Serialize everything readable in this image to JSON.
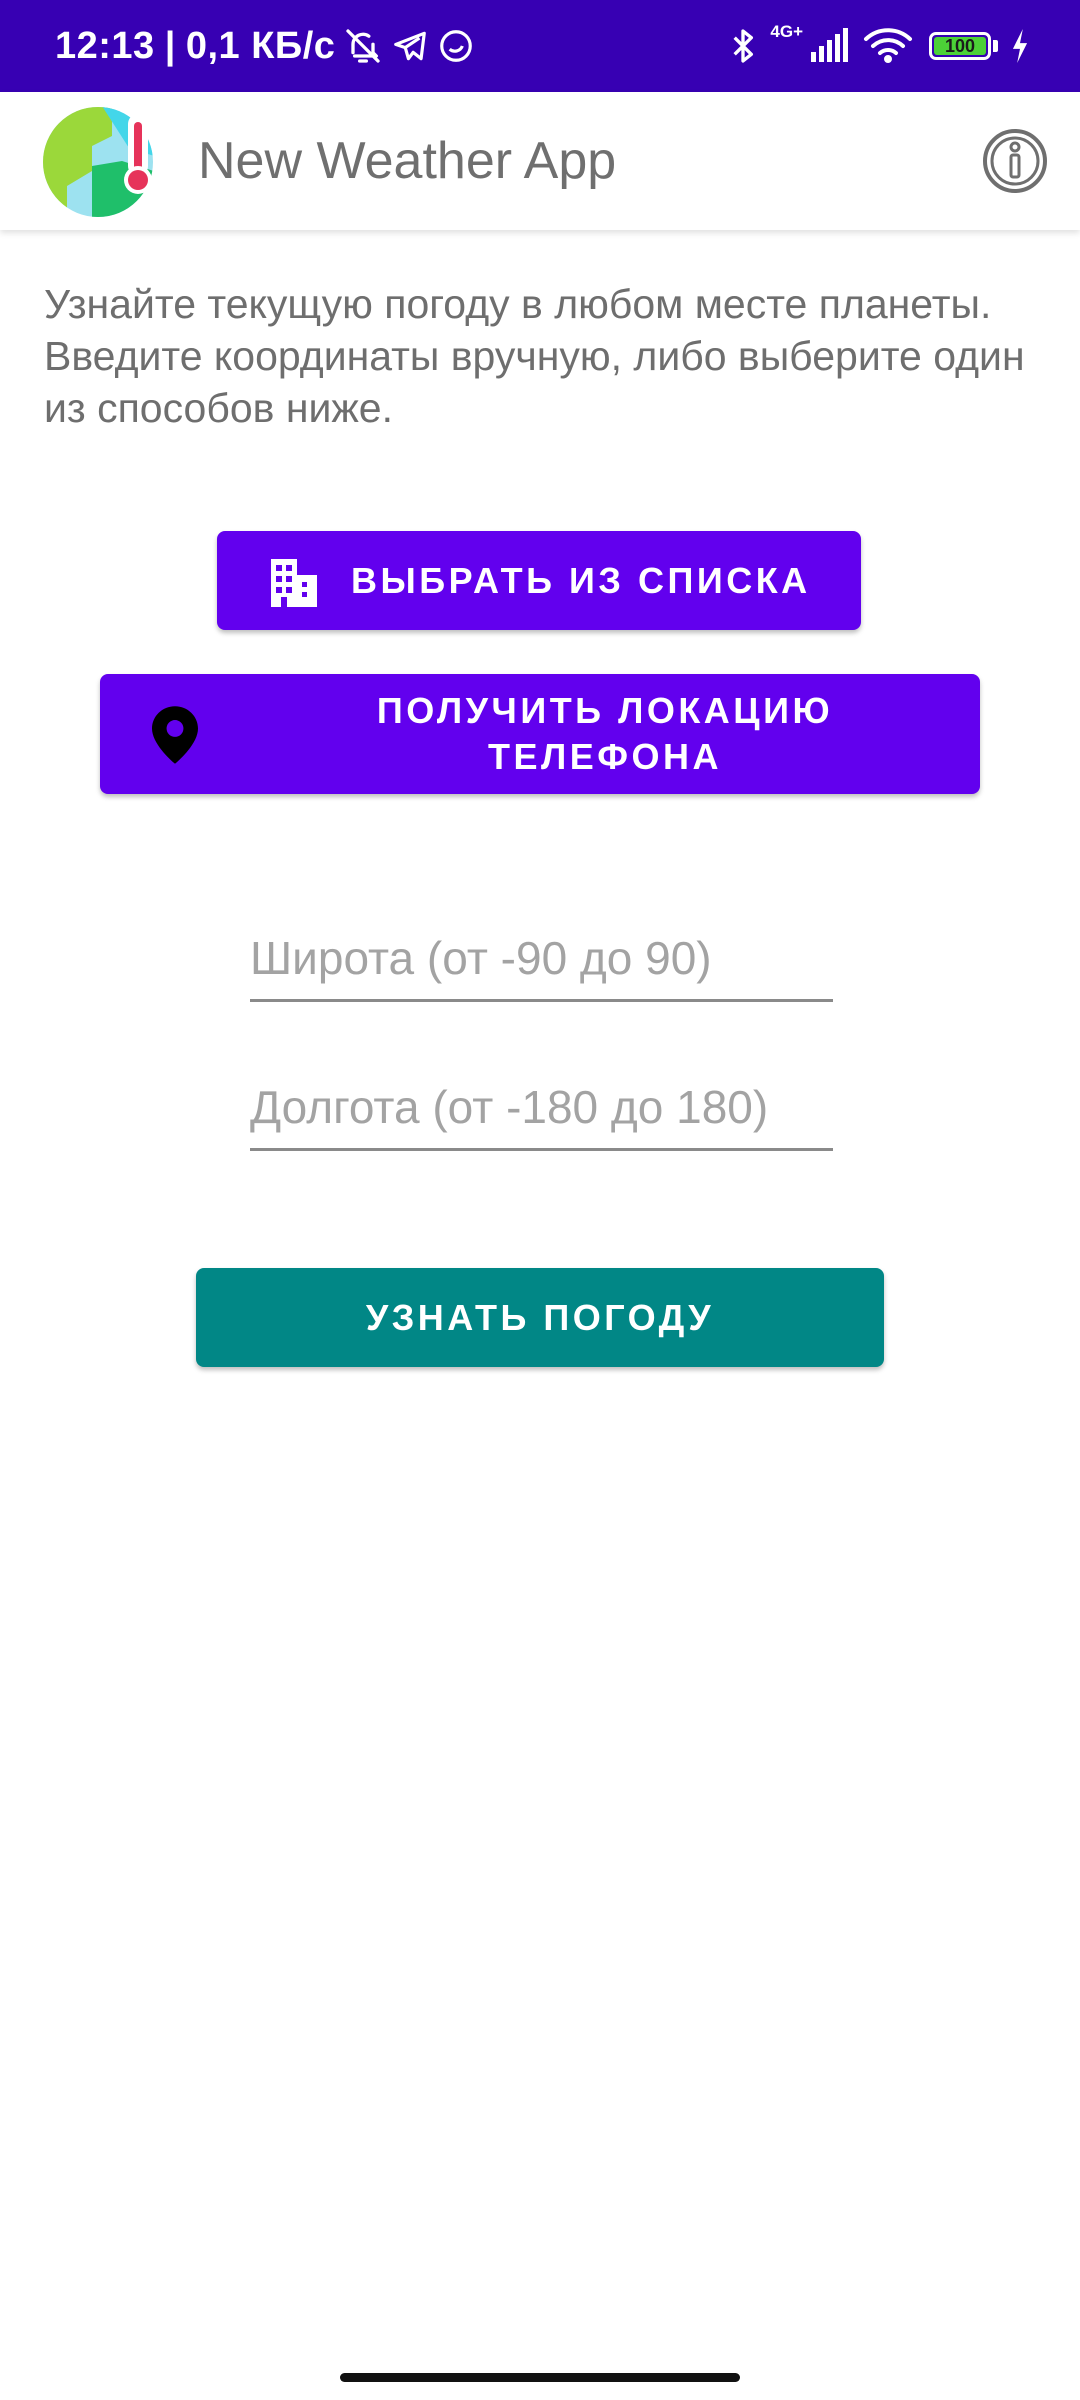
{
  "status_bar": {
    "time": "12:13",
    "separator": "|",
    "net_speed": "0,1 КБ/с",
    "network_type": "4G+",
    "battery_level": "100",
    "background_color": "#3700b3",
    "icons": [
      "bell-off-icon",
      "telegram-icon",
      "circle-notification-icon",
      "bluetooth-icon",
      "signal-icon",
      "wifi-icon",
      "battery-icon",
      "charging-icon"
    ]
  },
  "app_bar": {
    "title": "New Weather App",
    "logo_icon": "globe-thermometer-icon",
    "info_icon": "info-icon"
  },
  "main": {
    "description": "Узнайте текущую погоду в любом месте планеты. Введите координаты вручную, либо выберите один из способов ниже.",
    "choose_list_button": {
      "label": "ВЫБРАТЬ ИЗ СПИСКА",
      "icon": "city-icon"
    },
    "location_button": {
      "label": "ПОЛУЧИТЬ ЛОКАЦИЮ\nТЕЛЕФОНА",
      "icon": "location-pin-icon"
    },
    "latitude_input": {
      "value": "",
      "placeholder": "Широта (от -90 до 90)"
    },
    "longitude_input": {
      "value": "",
      "placeholder": "Долгота (от -180 до 180)"
    },
    "get_weather_button": {
      "label": "УЗНАТЬ ПОГОДУ"
    }
  },
  "colors": {
    "primary": "#6200ee",
    "primary_dark": "#3700b3",
    "secondary": "#018786",
    "text_secondary": "#6e6e6e"
  }
}
